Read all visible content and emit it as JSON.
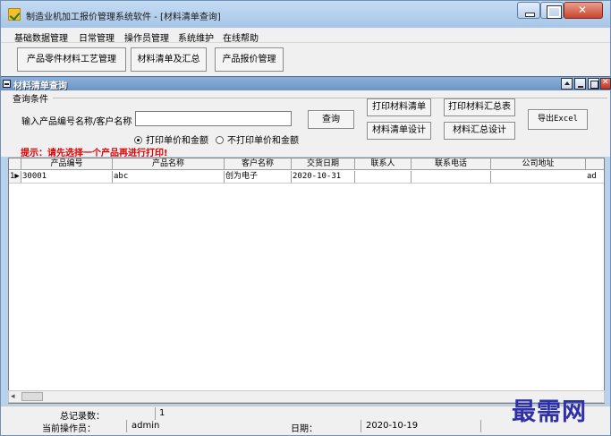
{
  "window": {
    "title": "制造业机加工报价管理系统软件 - [材料清单查询]"
  },
  "menu": [
    "基础数据管理",
    "日常管理",
    "操作员管理",
    "系统维护",
    "在线帮助"
  ],
  "toolbar": {
    "product_process": "产品零件材料工艺管理",
    "material_list": "材料清单及汇总",
    "product_quote": "产品报价管理"
  },
  "child_window": {
    "title": "材料清单查询"
  },
  "query": {
    "group_label": "查询条件",
    "input_label": "输入产品编号名称/客户名称",
    "input_value": "",
    "search_button": "查询",
    "print_list_button": "打印材料清单",
    "print_summary_button": "打印材料汇总表",
    "list_design_button": "材料清单设计",
    "summary_design_button": "材料汇总设计",
    "export_button": "导出Excel",
    "radio_print_price": "打印单价和金额",
    "radio_no_price": "不打印单价和金额",
    "radio_selected": "print_price",
    "hint": "提示：请先选择一个产品再进行打印!"
  },
  "grid": {
    "columns": [
      "产品编号",
      "产品名称",
      "客户名称",
      "交货日期",
      "联系人",
      "联系电话",
      "公司地址"
    ],
    "rows": [
      {
        "index": "1",
        "cells": [
          "30001",
          "abc",
          "创为电子",
          "2020-10-31",
          "",
          "",
          "ad"
        ]
      }
    ]
  },
  "status": {
    "total_label": "总记录数：",
    "total_value": "1",
    "operator_label": "当前操作员：",
    "operator_value": "admin",
    "date_label": "日期：",
    "date_value": "2020-10-19"
  },
  "watermark": "最需网"
}
